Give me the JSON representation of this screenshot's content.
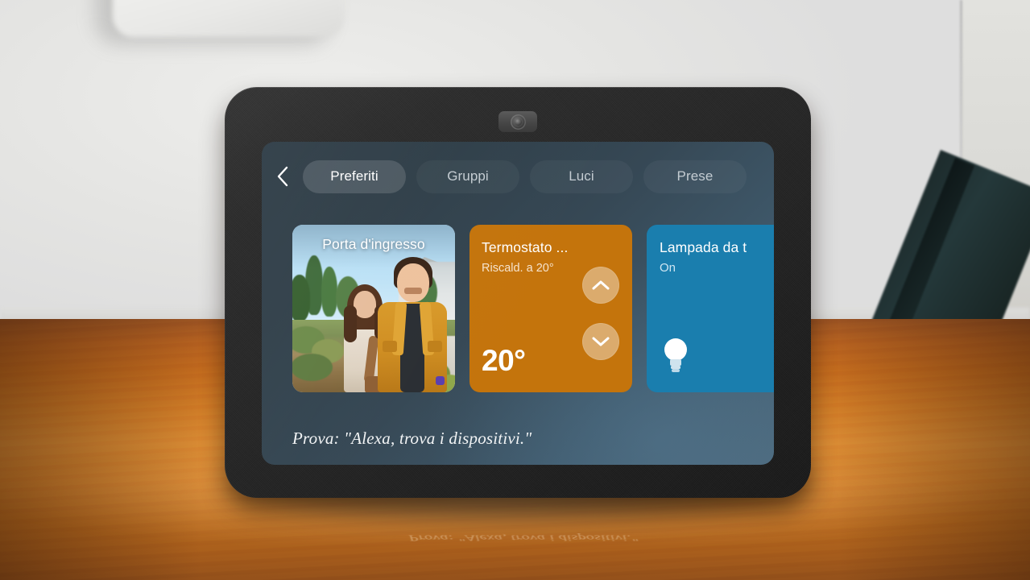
{
  "device": {
    "type": "smart-display",
    "camera_label": "front-camera"
  },
  "screen": {
    "nav": {
      "back_icon": "chevron-left-icon",
      "tabs": [
        {
          "label": "Preferiti",
          "active": true
        },
        {
          "label": "Gruppi",
          "active": false
        },
        {
          "label": "Luci",
          "active": false
        },
        {
          "label": "Prese",
          "active": false
        }
      ]
    },
    "cards": [
      {
        "id": "camera",
        "title": "Porta d'ingresso",
        "type": "camera-feed",
        "accent": "#bfe0f5"
      },
      {
        "id": "thermostat",
        "title": "Termostato  ...",
        "subtitle": "Riscald. a 20°",
        "temperature": "20°",
        "up_icon": "chevron-up-icon",
        "down_icon": "chevron-down-icon",
        "accent": "#c4740c"
      },
      {
        "id": "light",
        "title": "Lampada da t",
        "state": "On",
        "icon": "lightbulb-icon",
        "accent": "#1a7eae"
      }
    ],
    "prompt": "Prova: \"Alexa, trova i dispositivi.\"",
    "background_colors": {
      "top_left": "#2b3943",
      "bottom_right": "#4a6679"
    }
  },
  "reflection": {
    "text": "Prova: \"Alexa, trova i dispositivi.\""
  }
}
